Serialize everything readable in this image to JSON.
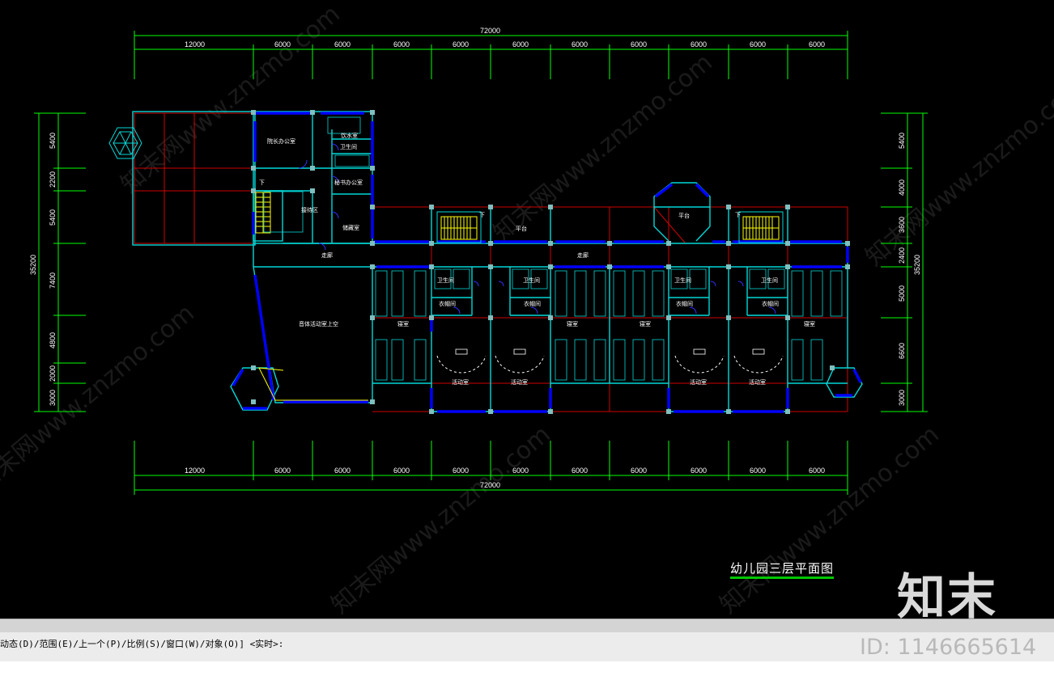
{
  "drawing": {
    "title": "幼儿园三层平面图",
    "total_dim": "72000",
    "top_dims": [
      "12000",
      "6000",
      "6000",
      "6000",
      "6000",
      "6000",
      "6000",
      "6000",
      "6000",
      "6000",
      "6000"
    ],
    "bottom_dims": [
      "12000",
      "6000",
      "6000",
      "6000",
      "6000",
      "6000",
      "6000",
      "6000",
      "6000",
      "6000",
      "6000"
    ],
    "left_dims": [
      "5400",
      "2200",
      "5400",
      "7400",
      "4800",
      "2000",
      "3000"
    ],
    "left_total": "35200",
    "right_dims": [
      "5400",
      "4000",
      "3600",
      "2400",
      "5000",
      "6600",
      "3000"
    ],
    "right_total": "35200",
    "rooms": {
      "director_office": "院长办公室",
      "water_room": "饮水室",
      "toilet_a": "卫生间",
      "secretary_office": "秘书办公室",
      "reception": "接待区",
      "storage": "储藏室",
      "platform_1": "平台",
      "platform_2": "平台",
      "corridor_1": "走廊",
      "corridor_2": "走廊",
      "gym_upper": "音体活动室上空",
      "stair_down_1": "下",
      "stair_down_2": "下",
      "stair_down_3": "下",
      "bedroom": "寝室",
      "toilet": "卫生间",
      "cloakroom": "衣帽间",
      "activity": "活动室"
    }
  },
  "command_line": {
    "text": "动态(D)/范围(E)/上一个(P)/比例(S)/窗口(W)/对象(O)] <实时>:"
  },
  "watermark": {
    "text": "知末网www.znzmo.com",
    "logo": "知末",
    "id": "ID: 1146665614"
  },
  "colors": {
    "background": "#000000",
    "dimension": "#00ff00",
    "wall": "#00ffff",
    "window": "#0000ff",
    "axis": "#ff0000",
    "stair": "#ffff00"
  }
}
